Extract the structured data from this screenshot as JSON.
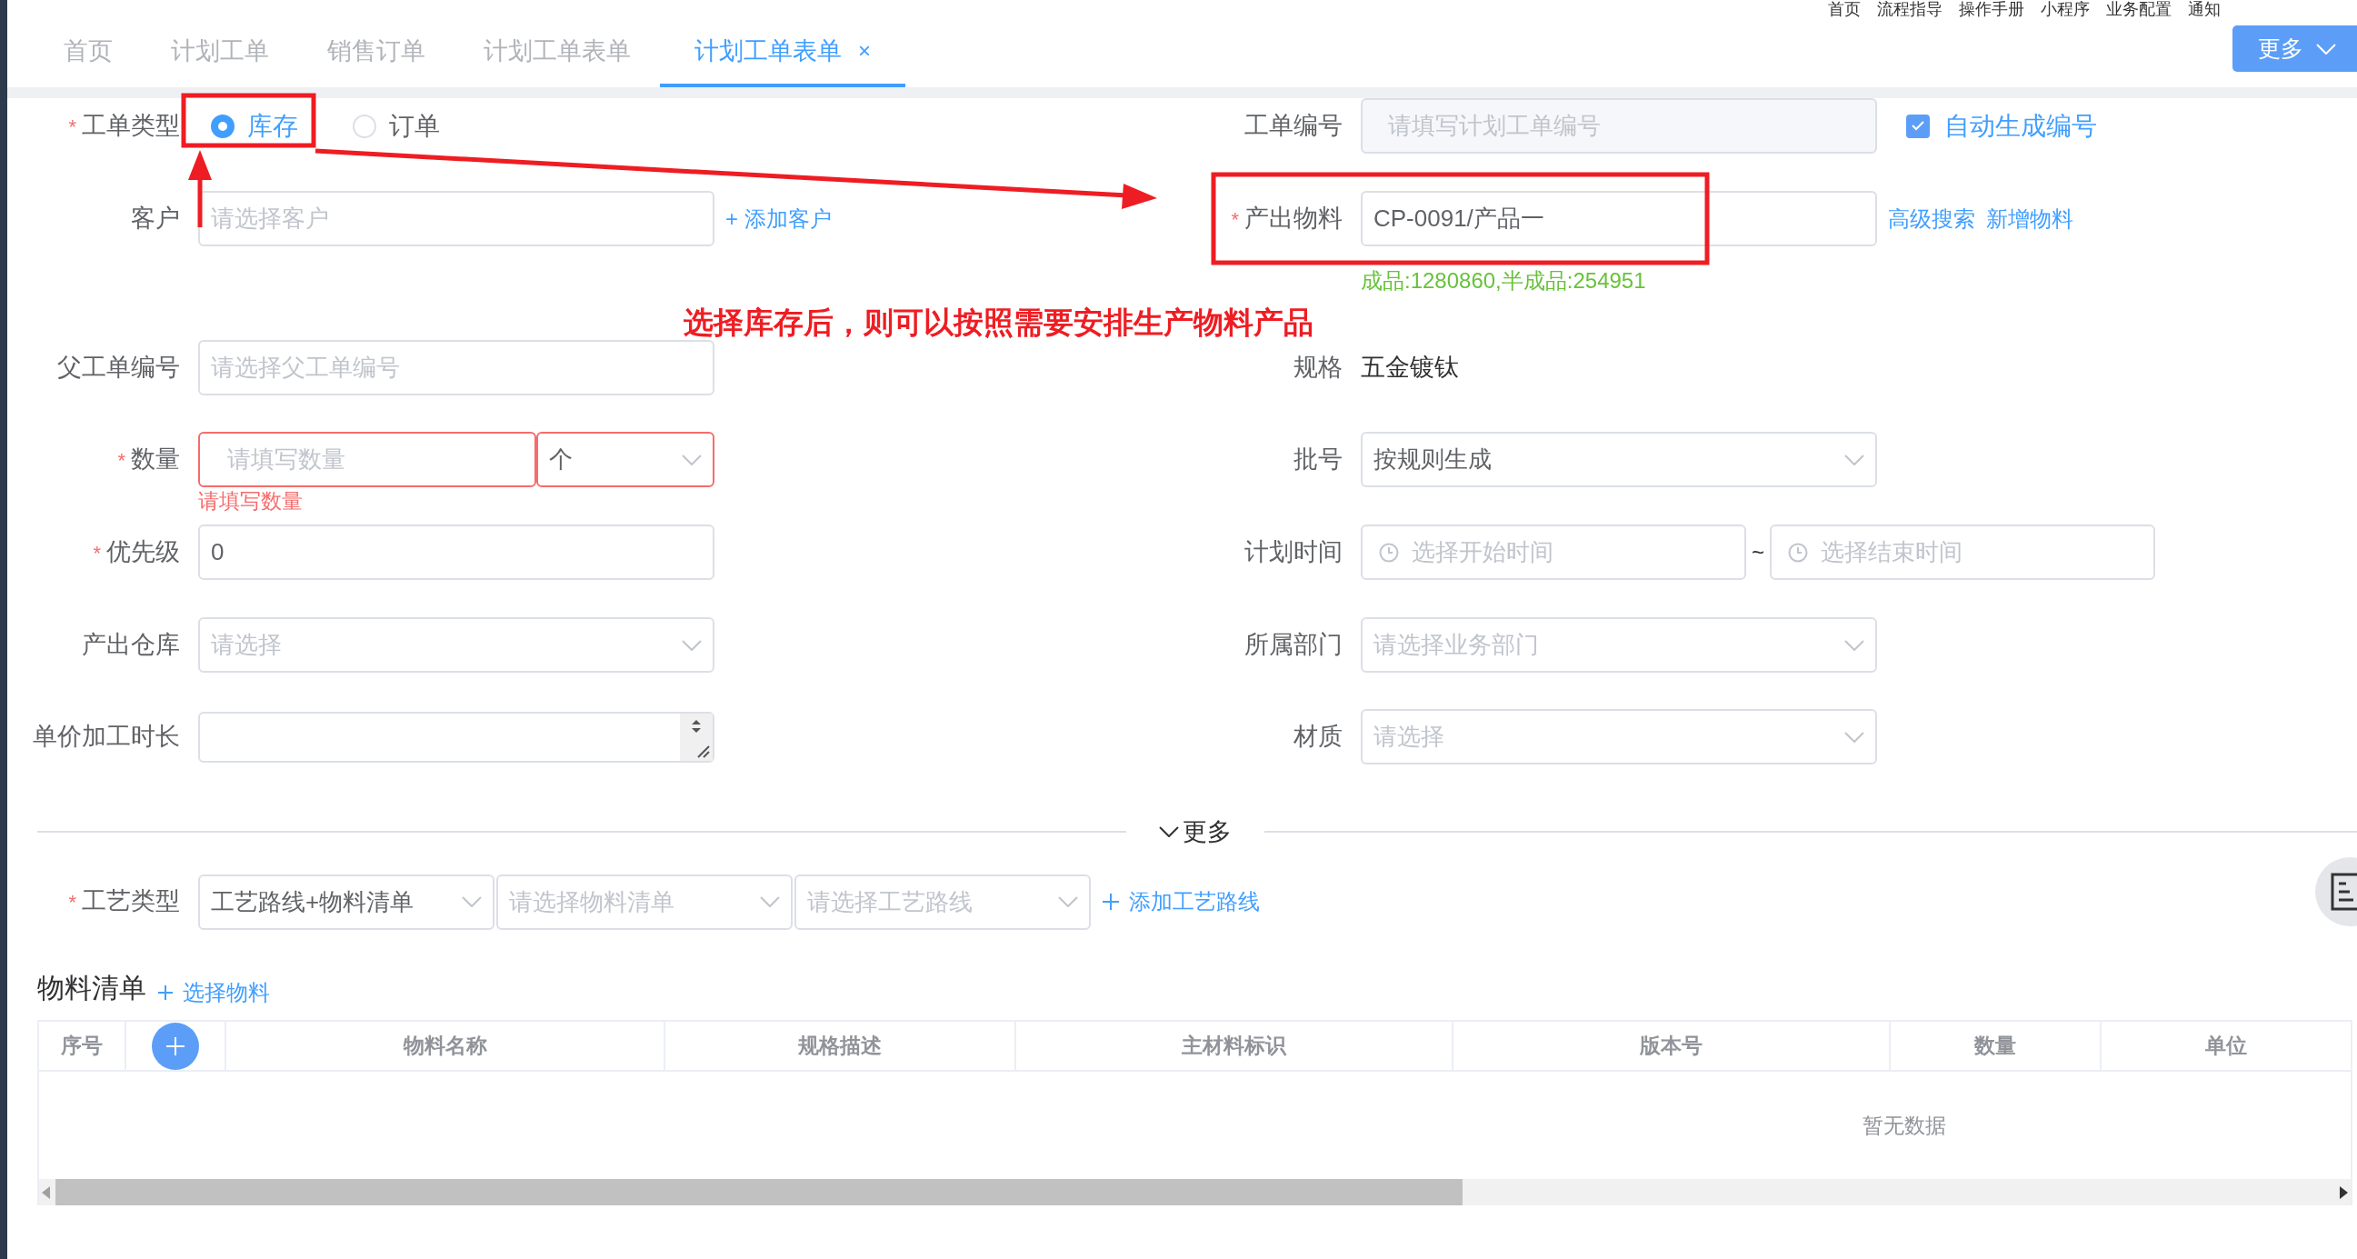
{
  "header_links": [
    "首页",
    "流程指导",
    "操作手册",
    "小程序",
    "业务配置",
    "通知"
  ],
  "tabs": [
    {
      "label": "首页",
      "selected": false
    },
    {
      "label": "计划工单",
      "selected": false
    },
    {
      "label": "销售订单",
      "selected": false
    },
    {
      "label": "计划工单表单",
      "selected": false
    },
    {
      "label": "计划工单表单",
      "selected": true,
      "close": "×"
    }
  ],
  "more_button": "更多",
  "form_rows": [
    {
      "left": {
        "kind": "radio",
        "label": "工单类型",
        "required_mark": "*",
        "options": [
          {
            "label": "库存",
            "selected": true
          },
          {
            "label": "订单",
            "selected": false
          }
        ]
      },
      "right": {
        "kind": "input",
        "label": "工单编号",
        "placeholder": "请填写计划工单编号",
        "disabled": true,
        "checkbox": {
          "label": "自动生成编号",
          "checked": true
        }
      }
    },
    {
      "left": {
        "kind": "input",
        "label": "客户",
        "placeholder": "请选择客户",
        "links": [
          "+ 添加客户"
        ]
      },
      "right": {
        "kind": "input",
        "label": "产出物料",
        "required_mark": "*",
        "value": "CP-0091/产品一",
        "links": [
          "高级搜索",
          "新增物料"
        ],
        "note": "成品:1280860,半成品:254951"
      }
    },
    {
      "left": {
        "kind": "input",
        "label": "父工单编号",
        "placeholder": "请选择父工单编号"
      },
      "right": {
        "kind": "text",
        "label": "规格",
        "value": "五金镀钛"
      }
    },
    {
      "left": {
        "kind": "input-unit",
        "label": "数量",
        "required_mark": "*",
        "placeholder": "请填写数量",
        "unit": "个",
        "error": "请填写数量"
      },
      "right": {
        "kind": "select",
        "label": "批号",
        "value": "按规则生成"
      }
    },
    {
      "left": {
        "kind": "input",
        "label": "优先级",
        "required_mark": "*",
        "value": "0"
      },
      "right": {
        "kind": "daterange",
        "label": "计划时间",
        "start_placeholder": "选择开始时间",
        "separator": "~",
        "end_placeholder": "选择结束时间"
      }
    },
    {
      "left": {
        "kind": "select",
        "label": "产出仓库",
        "placeholder": "请选择"
      },
      "right": {
        "kind": "select",
        "label": "所属部门",
        "placeholder": "请选择业务部门"
      }
    },
    {
      "left": {
        "kind": "stepper",
        "label": "单价加工时长"
      },
      "right": {
        "kind": "select",
        "label": "材质",
        "placeholder": "请选择"
      }
    }
  ],
  "annotation": "选择库存后，则可以按照需要安排生产物料产品",
  "divider_toggle": "更多",
  "process_row": {
    "label": "工艺类型",
    "required_mark": "*",
    "selects": [
      {
        "value": "工艺路线+物料清单"
      },
      {
        "placeholder": "请选择物料清单"
      },
      {
        "placeholder": "请选择工艺路线"
      }
    ],
    "link": "添加工艺路线"
  },
  "material_list": {
    "title": "物料清单",
    "link": "选择物料",
    "columns": [
      {
        "kind": "text",
        "label": "序号"
      },
      {
        "kind": "add"
      },
      {
        "kind": "text",
        "label": "物料名称"
      },
      {
        "kind": "text",
        "label": "规格描述"
      },
      {
        "kind": "text",
        "label": "主材料标识"
      },
      {
        "kind": "text",
        "label": "版本号"
      },
      {
        "kind": "text",
        "label": "数量"
      },
      {
        "kind": "text",
        "label": "单位"
      }
    ],
    "empty_text": "暂无数据"
  }
}
